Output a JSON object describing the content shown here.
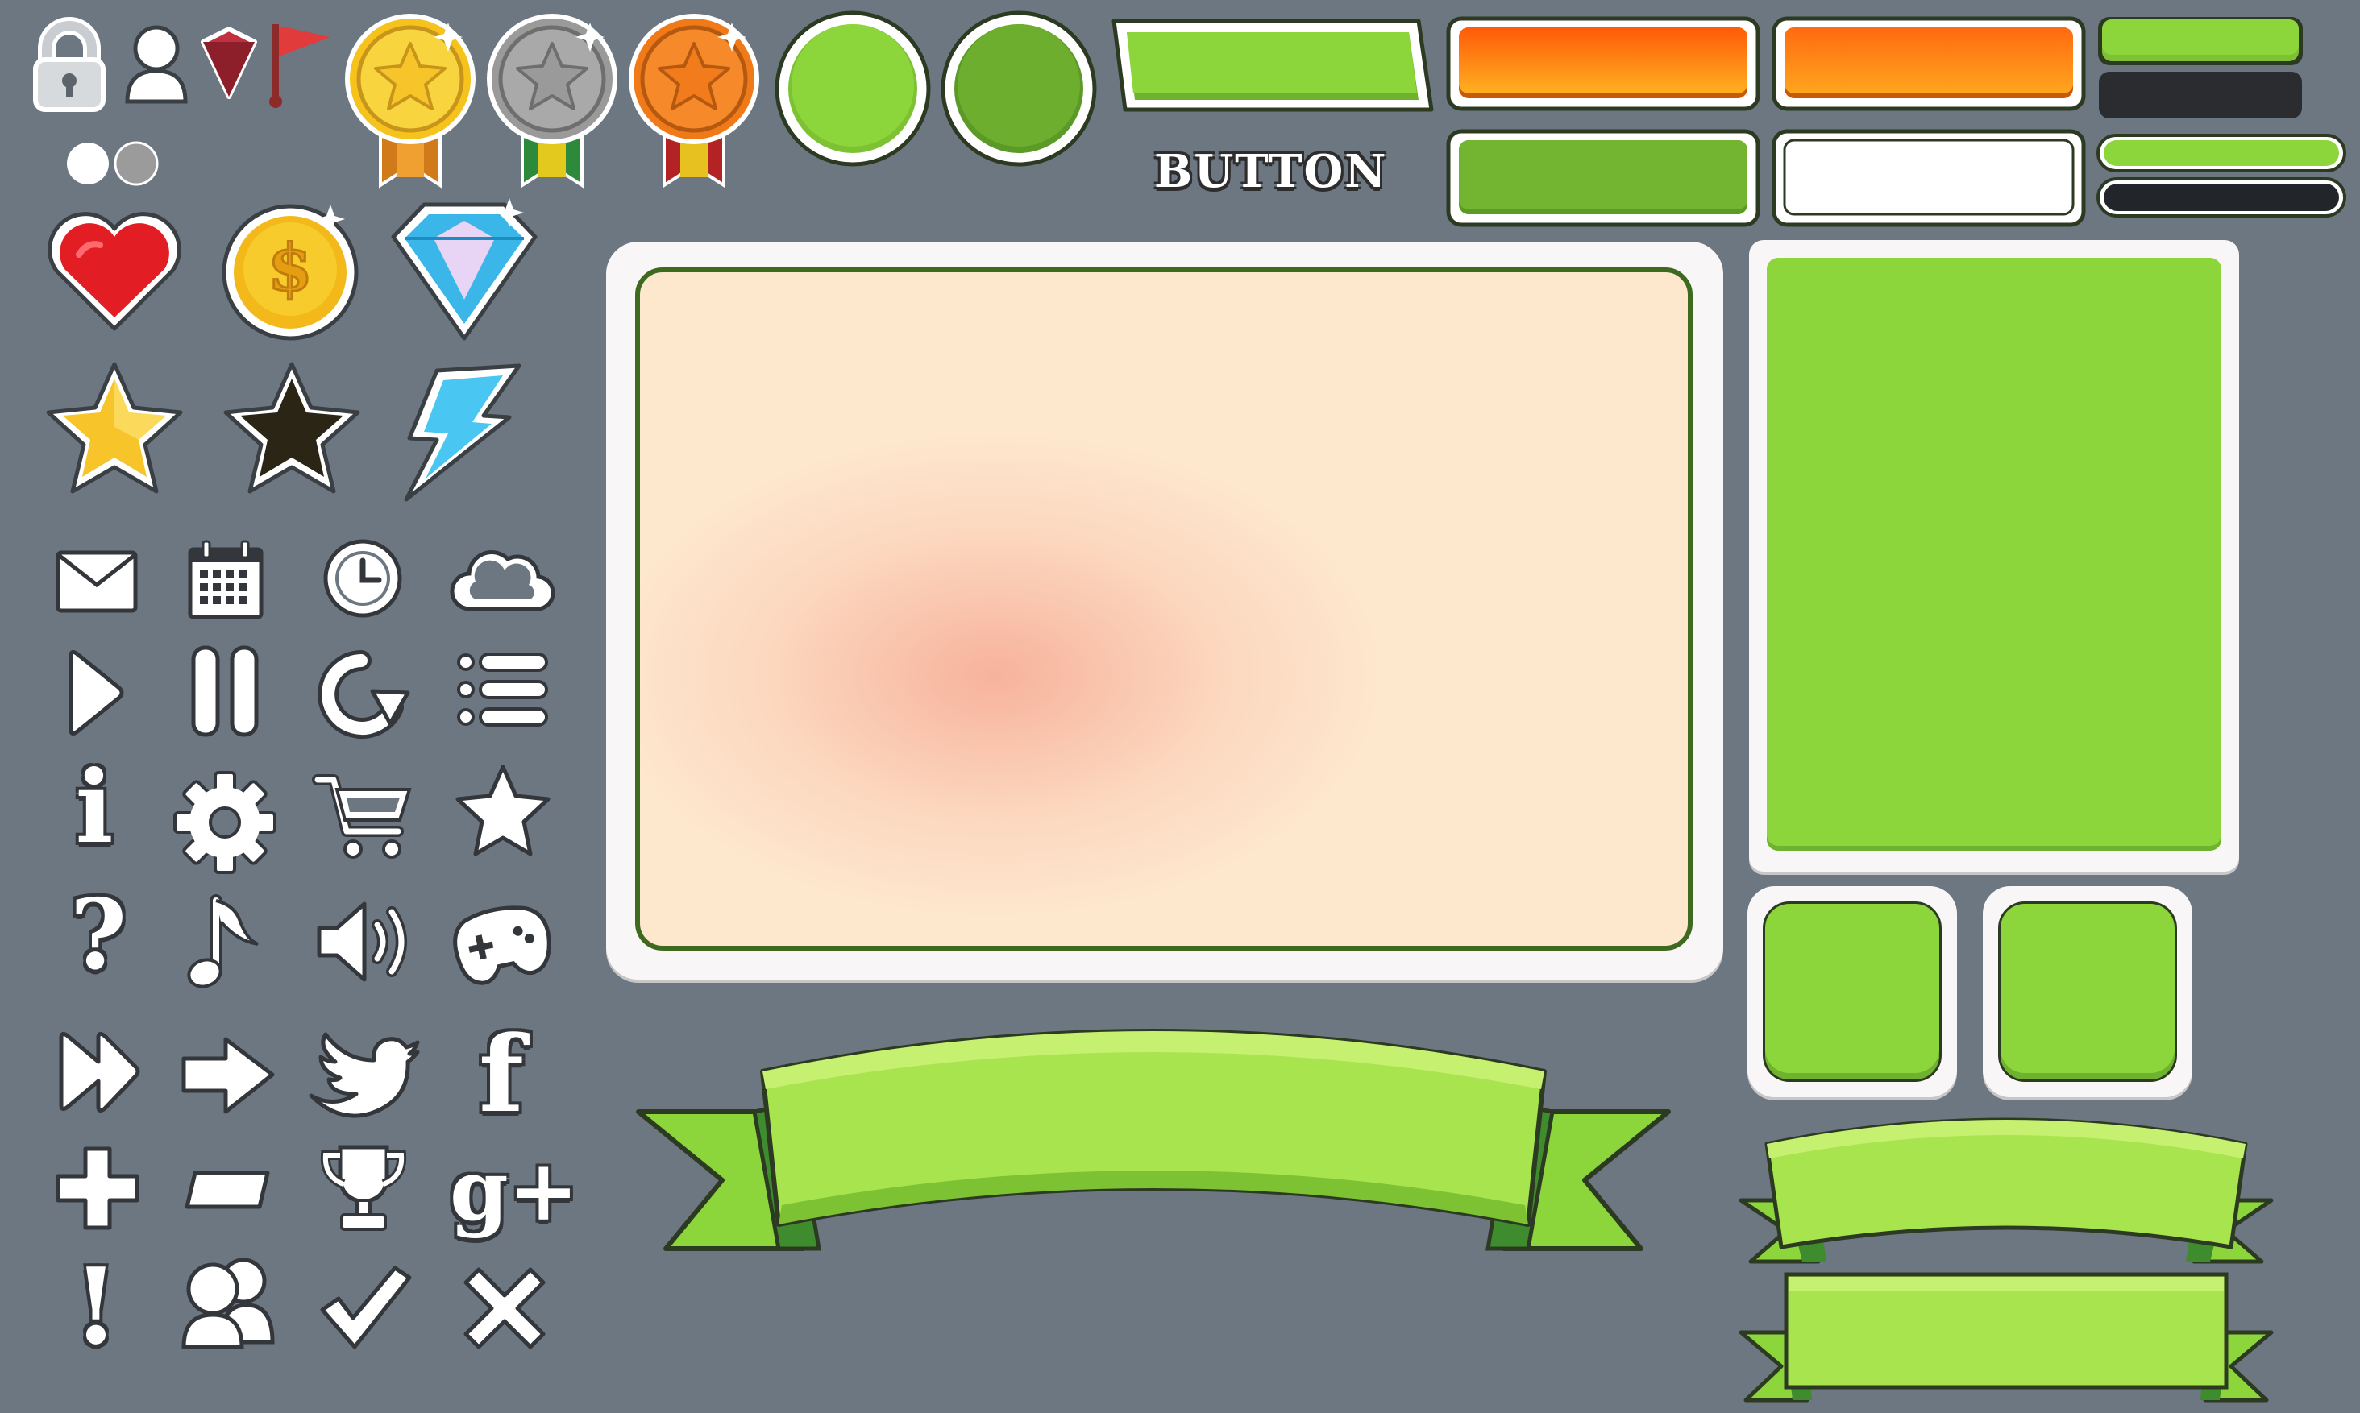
{
  "colors": {
    "background": "#6d7782",
    "green": "#8cd63c",
    "dark_green": "#6fb22f",
    "orange": "#ff7a10",
    "panel_cream": "#fde6cc",
    "panel_white": "#f8f6f6",
    "outline": "#2f3a22"
  },
  "labels": {
    "button": "BUTTON",
    "info_glyph": "i",
    "question_glyph": "?",
    "facebook_glyph": "f",
    "google_plus_glyph": "g+",
    "exclamation_glyph": "!"
  },
  "icons": [
    "lock-icon",
    "user-icon",
    "gem-icon",
    "flag-icon",
    "gold-medal-icon",
    "silver-medal-icon",
    "bronze-medal-icon",
    "heart-icon",
    "coin-icon",
    "diamond-icon",
    "gold-star-icon",
    "dark-star-icon",
    "lightning-icon",
    "mail-icon",
    "calendar-icon",
    "clock-icon",
    "cloud-icon",
    "play-icon",
    "pause-icon",
    "restart-icon",
    "list-icon",
    "info-icon",
    "gear-icon",
    "cart-icon",
    "star-icon",
    "question-icon",
    "music-icon",
    "sound-icon",
    "gamepad-icon",
    "fast-forward-icon",
    "arrow-right-icon",
    "twitter-icon",
    "facebook-icon",
    "plus-icon",
    "minus-icon",
    "trophy-icon",
    "google-plus-icon",
    "exclamation-icon",
    "friends-icon",
    "check-icon",
    "close-icon"
  ],
  "indicators": {
    "dots": [
      "active",
      "inactive"
    ]
  },
  "progress_bars": [
    {
      "name": "bar-top",
      "fill": 1.0
    },
    {
      "name": "bar-bottom",
      "fill": 1.0
    }
  ]
}
